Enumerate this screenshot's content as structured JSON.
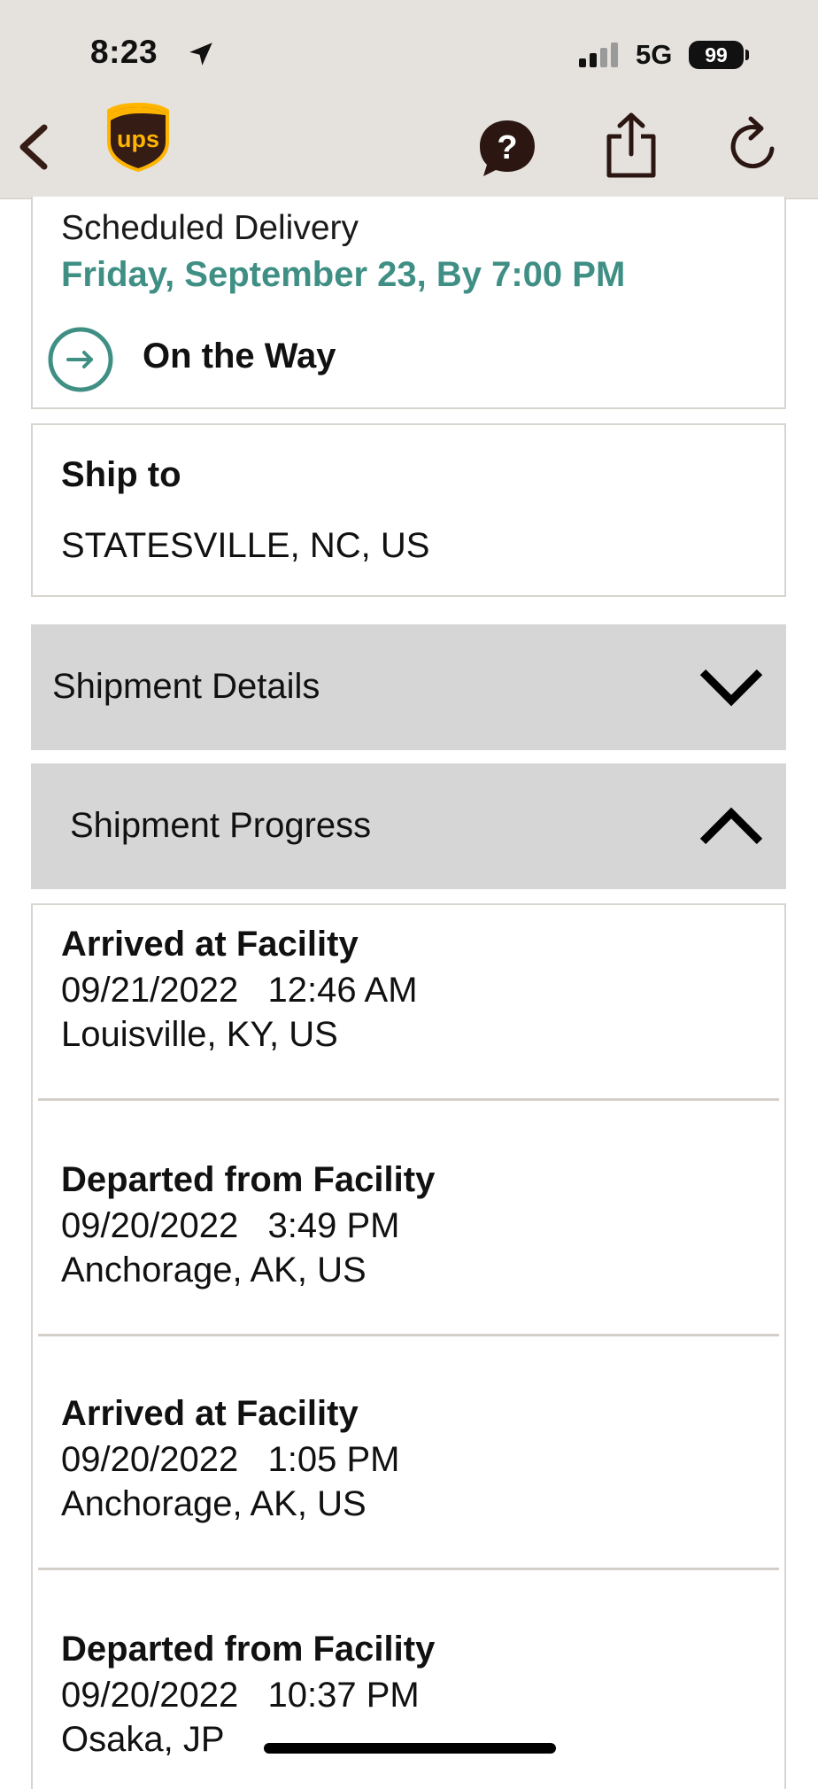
{
  "status_bar": {
    "time": "8:23",
    "network": "5G",
    "battery": "99"
  },
  "header": {
    "back_icon": "chevron-left-icon",
    "logo_text": "ups",
    "help_icon": "help-chat-icon",
    "share_icon": "share-icon",
    "refresh_icon": "refresh-icon"
  },
  "delivery": {
    "label": "Scheduled Delivery",
    "date": "Friday, September 23, By 7:00 PM",
    "status": "On the Way"
  },
  "ship_to": {
    "label": "Ship to",
    "value": "STATESVILLE, NC, US"
  },
  "sections": {
    "details_label": "Shipment Details",
    "progress_label": "Shipment Progress"
  },
  "events": [
    {
      "title": "Arrived at Facility",
      "datetime": "09/21/2022   12:46 AM",
      "location": "Louisville, KY, US"
    },
    {
      "title": "Departed from Facility",
      "datetime": "09/20/2022   3:49 PM",
      "location": "Anchorage, AK, US"
    },
    {
      "title": "Arrived at Facility",
      "datetime": "09/20/2022   1:05 PM",
      "location": "Anchorage, AK, US"
    },
    {
      "title": "Departed from Facility",
      "datetime": "09/20/2022   10:37 PM",
      "location": "Osaka, JP"
    }
  ],
  "colors": {
    "brand_brown": "#351c15",
    "brand_gold": "#ffb500",
    "accent_teal": "#3f8f85",
    "header_bg": "#e5e2de",
    "accordion_bg": "#d6d6d6"
  }
}
